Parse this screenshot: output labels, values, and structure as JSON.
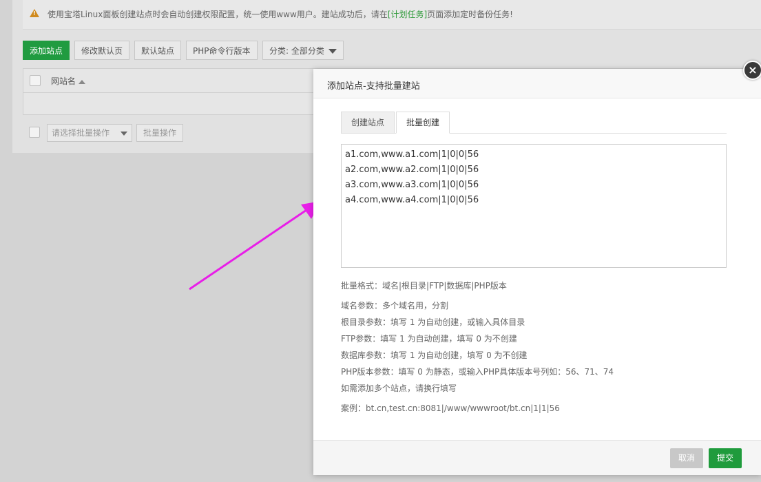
{
  "notice": {
    "text_before": "使用宝塔Linux面板创建站点时会自动创建权限配置，统一使用www用户。建站成功后，请在",
    "link": "[计划任务]",
    "text_after": "页面添加定时备份任务!"
  },
  "toolbar": {
    "add_site": "添加站点",
    "edit_default_page": "修改默认页",
    "default_site": "默认站点",
    "php_cli_version": "PHP命令行版本",
    "category_select": "分类: 全部分类"
  },
  "table": {
    "col_site_name": "网站名"
  },
  "bottom_bar": {
    "batch_select_placeholder": "请选择批量操作",
    "batch_button": "批量操作"
  },
  "dialog": {
    "title": "添加站点-支持批量建站",
    "close": "×",
    "tabs": [
      "创建站点",
      "批量创建"
    ],
    "active_tab": "批量创建",
    "textarea_value": "a1.com,www.a1.com|1|0|0|56\na2.com,www.a2.com|1|0|0|56\na3.com,www.a3.com|1|0|0|56\na4.com,www.a4.com|1|0|0|56",
    "help": {
      "format": "批量格式：域名|根目录|FTP|数据库|PHP版本",
      "domain": "域名参数：多个域名用，分割",
      "root": "根目录参数：填写 1 为自动创建，或输入具体目录",
      "ftp": "FTP参数：填写 1 为自动创建，填写 0 为不创建",
      "db": "数据库参数：填写 1 为自动创建，填写 0 为不创建",
      "php": "PHP版本参数：填写 0 为静态，或输入PHP具体版本号列如：56、71、74",
      "multi": "如需添加多个站点，请换行填写",
      "example": "案例：bt.cn,test.cn:8081|/www/wwwroot/bt.cn|1|1|56"
    },
    "cancel": "取消",
    "submit": "提交"
  },
  "colors": {
    "primary_green": "#209b40",
    "arrow_magenta": "#e81ee8",
    "warning_orange": "#d08a1d"
  }
}
